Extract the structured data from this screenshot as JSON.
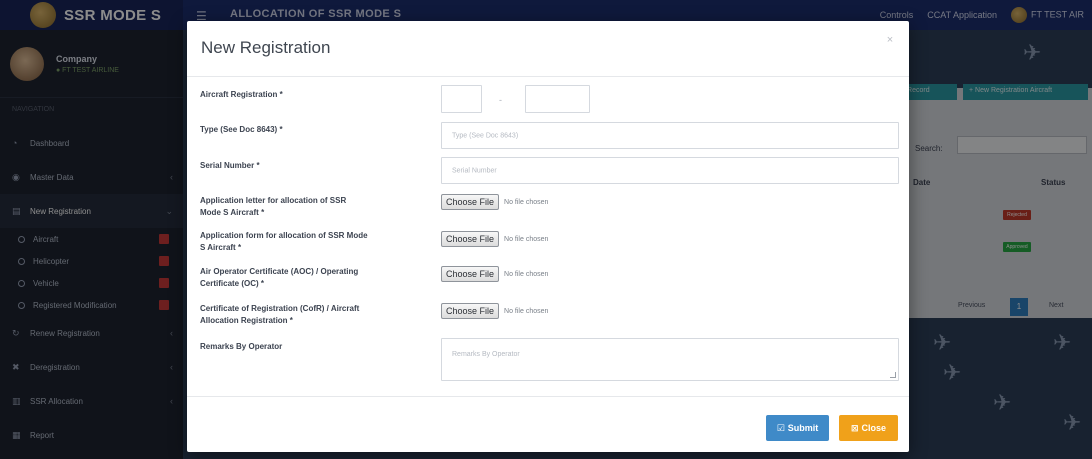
{
  "app": {
    "brand": "SSR MODE S",
    "page_heading": "ALLOCATION OF SSR MODE S",
    "top_right": {
      "item1": "Controls",
      "item2": "CCAT Application",
      "user": "FT TEST AIR"
    }
  },
  "sidebar": {
    "profile_name": "Company",
    "profile_status": "● FT TEST AIRLINE",
    "section_label": "NAVIGATION",
    "items": [
      {
        "label": "Dashboard",
        "icon": "dashboard-icon"
      },
      {
        "label": "Master Data",
        "icon": "database-icon"
      },
      {
        "label": "New Registration",
        "icon": "list-icon"
      }
    ],
    "sub_items": [
      {
        "label": "Aircraft"
      },
      {
        "label": "Helicopter"
      },
      {
        "label": "Vehicle"
      },
      {
        "label": "Registered Modification"
      }
    ],
    "items2": [
      {
        "label": "Renew Registration",
        "icon": "refresh-icon"
      },
      {
        "label": "Deregistration",
        "icon": "x-icon"
      },
      {
        "label": "SSR Allocation",
        "icon": "chart-icon"
      },
      {
        "label": "Report",
        "icon": "report-icon"
      }
    ]
  },
  "background": {
    "header_buttons": [
      "+ Record",
      "+ New Registration Aircraft"
    ],
    "search_label": "Search:",
    "columns": [
      "Date",
      "Status"
    ],
    "statuses": [
      {
        "label": "Rejected",
        "color": "#c0392b"
      },
      {
        "label": "Approved",
        "color": "#27a844"
      }
    ],
    "pager": {
      "prev": "Previous",
      "current": "1",
      "next": "Next"
    }
  },
  "modal": {
    "title": "New Registration",
    "close": "×",
    "fields": {
      "aircraft_registration": {
        "label": "Aircraft Registration",
        "separator": "-"
      },
      "type": {
        "label": "Type (See Doc 8643)",
        "placeholder": "Type (See Doc 8643)"
      },
      "serial_number": {
        "label": "Serial Number",
        "placeholder": "Serial Number"
      },
      "app_letter": {
        "label_line1": "Application letter for allocation of SSR",
        "label_line2": "Mode S Aircraft"
      },
      "app_form": {
        "label_line1": "Application form for allocation of SSR Mode",
        "label_line2": "S Aircraft"
      },
      "aoc": {
        "label_line1": "Air Operator Certificate (AOC) / Operating",
        "label_line2": "Certificate (OC)"
      },
      "cofr": {
        "label_line1": "Certificate of Registration (CofR) / Aircraft",
        "label_line2": "Allocation Registration"
      },
      "remarks": {
        "label": "Remarks By Operator",
        "placeholder": "Remarks By Operator"
      }
    },
    "required_mark": "*",
    "file_button": "Choose File",
    "file_note": "No file chosen",
    "submit": {
      "icon": "check-square-icon",
      "label": "Submit"
    },
    "close_btn": {
      "icon": "close-square-icon",
      "label": "Close"
    }
  }
}
